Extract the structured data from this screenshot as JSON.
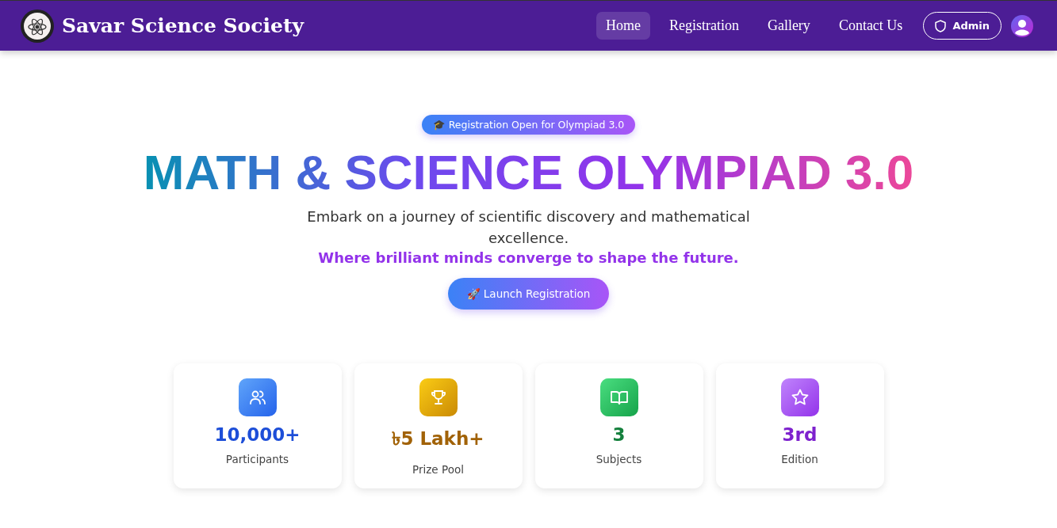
{
  "brand": {
    "name": "Savar Science Society"
  },
  "nav": [
    {
      "label": "Home",
      "selected": true
    },
    {
      "label": "Registration",
      "selected": false
    },
    {
      "label": "Gallery",
      "selected": false
    },
    {
      "label": "Contact Us",
      "selected": false
    }
  ],
  "admin_button": "Admin",
  "hero": {
    "badge": "🎓 Registration Open for Olympiad 3.0",
    "title": "MATH & SCIENCE OLYMPIAD 3.0",
    "description": "Embark on a journey of scientific discovery and mathematical excellence.",
    "tagline": "Where brilliant minds converge to shape the future.",
    "cta": "🚀 Launch Registration"
  },
  "stats": [
    {
      "kind": "people",
      "value": "10,000+",
      "label": "Participants",
      "color": "#1d4ed8"
    },
    {
      "kind": "trophy",
      "value": "৳5 Lakh+",
      "label": "Prize Pool",
      "color": "#a16207"
    },
    {
      "kind": "book",
      "value": "3",
      "label": "Subjects",
      "color": "#15803d"
    },
    {
      "kind": "star",
      "value": "3rd",
      "label": "Edition",
      "color": "#7e22ce"
    }
  ]
}
